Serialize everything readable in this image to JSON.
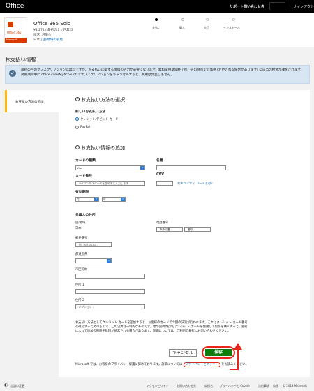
{
  "topbar": {
    "brand": "Office",
    "support": "サポート問い合わせ先",
    "signin": "サインアウト"
  },
  "product": {
    "icon_top": "Office 365",
    "icon_bottom": "Microsoft",
    "name": "Office 365 Solo",
    "price": "¥1,274 | 最初の１か月無料",
    "billing": "請求: 月単位",
    "country": "日本",
    "change_link": "国/地域の変更"
  },
  "steps": [
    "支払い",
    "購入",
    "完了",
    "インストール"
  ],
  "page_title": "お支払い情報",
  "info_text": "最初の月のサブスクリプションは無料ですが、お支払いに関する情報の入力が必要になります。無料試用期間終了後、その時点での価格 (変更される場合があります) に該当の税金が課金されます。 試用期間中に office.com/MyAccount でサブスクリプションをキャンセルすると、費用は発生しません。",
  "sidebar": {
    "item": "お支払い方法の追加"
  },
  "method": {
    "title": "お支払い方法の選択",
    "subtitle": "新しいお支払い方法",
    "option1": "クレジット/デビット カード",
    "option2": "PayPal"
  },
  "details": {
    "title": "お支払い情報の追加",
    "card_type_label": "カードの種類",
    "card_type_value": "Visa",
    "name_label": "名義",
    "card_number_label": "カード番号",
    "card_number_placeholder": "- ハイフンやスペースを含めずに入力します",
    "cvv_label": "CVV",
    "security_link": "セキュリティ コードとは?",
    "expiry_label": "有効期限",
    "month_value": "月",
    "year_value": "年"
  },
  "address": {
    "title": "名義人の住所",
    "country_label": "国/地域",
    "country_value": "日本",
    "phone_label": "電話番号",
    "phone_area": "- 市外局番 -",
    "phone_number": "- 番号 -",
    "postal_label": "郵便番号",
    "postal_placeholder": "- 例: 162-0021 -",
    "prefecture_label": "都道府県",
    "city_label": "市区町村",
    "address1_label": "住所 1",
    "address2_label": "住所 2",
    "address2_placeholder": "- オプション -"
  },
  "notice": "お支払い方法としてクレジット カードを追加すると、お客様のカードで少額の決済が行われます。これはクレジット カード番号を確認するためのもので、この決済は一時的なものです。他の国/地域からクレジット カードを使用して何かを購入すると、銀行によって追加の利用手数料が請求される場合があります。詳細については、ご利用の銀行にお問い合わせください。",
  "buttons": {
    "cancel": "キャンセル",
    "save": "保存"
  },
  "privacy": {
    "prefix": "Microsoft では、お客様のプライバシー保護に努めております。詳細については",
    "link": "プライバシーとクッキー",
    "suffix": "をお読みください。"
  },
  "footer": {
    "lang": "言語の変更",
    "links": [
      "アクセシビリティ",
      "お問い合わせ先",
      "商標名",
      "プライバシーと Cookie",
      "法的事項",
      "商標",
      "© 2018 Microsoft"
    ]
  },
  "colors": {
    "accent": "#0067b8",
    "save": "#107c10",
    "highlight": "#e8261b",
    "sidebar_marker": "#ffb900"
  }
}
